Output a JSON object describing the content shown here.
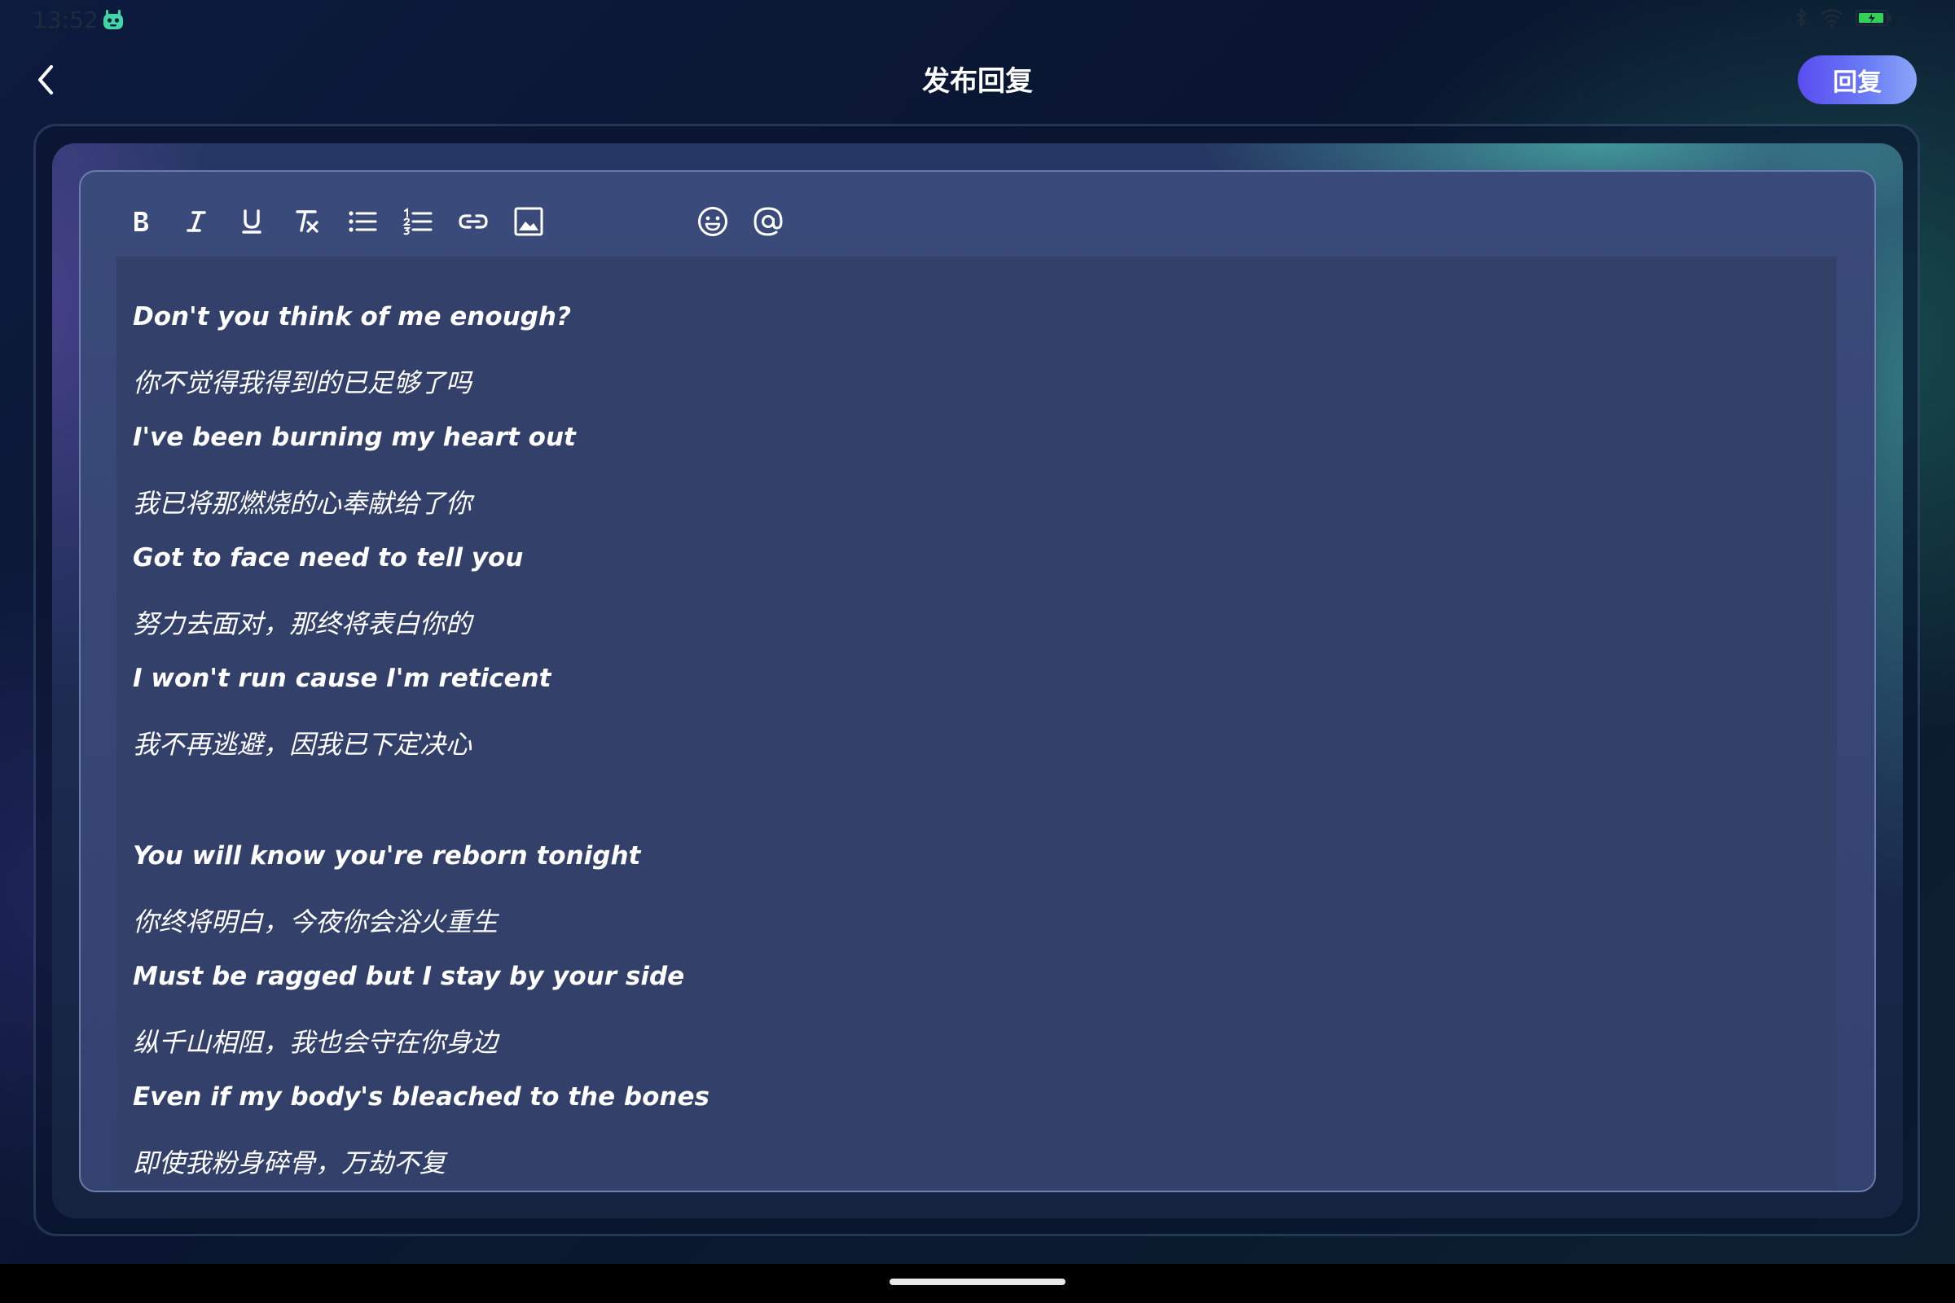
{
  "status_bar": {
    "time": "13:52"
  },
  "header": {
    "title": "发布回复",
    "reply_label": "回复"
  },
  "toolbar": {
    "items": [
      {
        "icon": "bold-icon"
      },
      {
        "icon": "italic-icon"
      },
      {
        "icon": "underline-icon"
      },
      {
        "icon": "clear-format-icon"
      },
      {
        "icon": "bullet-list-icon"
      },
      {
        "icon": "numbered-list-icon"
      },
      {
        "icon": "link-icon"
      },
      {
        "icon": "image-icon"
      },
      {
        "icon": "emoji-icon"
      },
      {
        "icon": "mention-icon"
      }
    ]
  },
  "editor": {
    "lines": [
      "Don't you think of me enough?",
      "你不觉得我得到的已足够了吗",
      "I've been burning my heart out",
      "我已将那燃烧的心奉献给了你",
      "Got to face need to tell you",
      "努力去面对，那终将表白你的",
      "I won't run cause I'm reticent",
      "我不再逃避，因我已下定决心",
      "You will know you're reborn tonight",
      "你终将明白，今夜你会浴火重生",
      "Must be ragged but I stay by your side",
      "纵千山相阻，我也会守在你身边",
      "Even if my body's bleached to the bones",
      "即使我粉身碎骨，万劫不复"
    ]
  },
  "colors": {
    "accent": "#5a4cf0",
    "editor_bg": "#32406a",
    "text": "#ffffff"
  }
}
